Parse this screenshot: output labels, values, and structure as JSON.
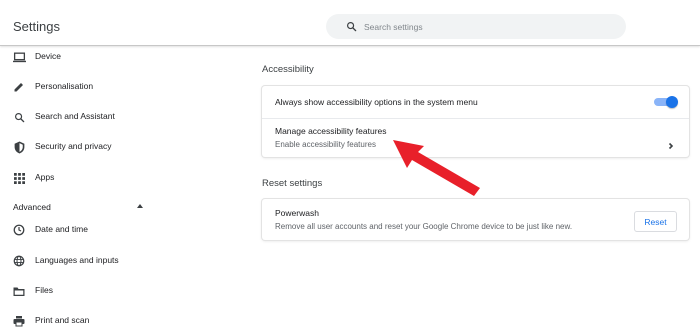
{
  "header": {
    "title": "Settings",
    "search_placeholder": "Search settings"
  },
  "sidebar": {
    "items": [
      {
        "label": "Device",
        "icon": "laptop-icon"
      },
      {
        "label": "Personalisation",
        "icon": "pencil-icon"
      },
      {
        "label": "Search and Assistant",
        "icon": "search-icon"
      },
      {
        "label": "Security and privacy",
        "icon": "shield-icon"
      },
      {
        "label": "Apps",
        "icon": "apps-grid-icon"
      }
    ],
    "advanced_label": "Advanced",
    "advanced_items": [
      {
        "label": "Date and time",
        "icon": "clock-icon"
      },
      {
        "label": "Languages and inputs",
        "icon": "globe-icon"
      },
      {
        "label": "Files",
        "icon": "folder-icon"
      },
      {
        "label": "Print and scan",
        "icon": "printer-icon"
      }
    ]
  },
  "main": {
    "accessibility": {
      "title": "Accessibility",
      "toggle_label": "Always show accessibility options in the system menu",
      "toggle_on": true,
      "manage_label": "Manage accessibility features",
      "manage_sub": "Enable accessibility features"
    },
    "reset": {
      "title": "Reset settings",
      "powerwash_label": "Powerwash",
      "powerwash_sub": "Remove all user accounts and reset your Google Chrome device to be just like new.",
      "button_label": "Reset"
    }
  },
  "colors": {
    "accent": "#1a73e8",
    "annotation_arrow": "#e8202a"
  }
}
